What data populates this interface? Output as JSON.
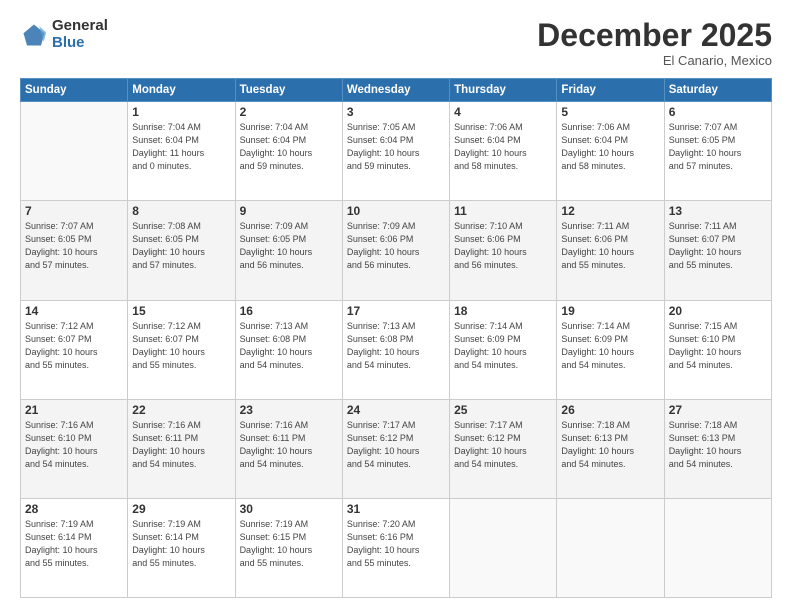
{
  "logo": {
    "general": "General",
    "blue": "Blue"
  },
  "header": {
    "month": "December 2025",
    "location": "El Canario, Mexico"
  },
  "weekdays": [
    "Sunday",
    "Monday",
    "Tuesday",
    "Wednesday",
    "Thursday",
    "Friday",
    "Saturday"
  ],
  "weeks": [
    [
      {
        "day": "",
        "info": ""
      },
      {
        "day": "1",
        "info": "Sunrise: 7:04 AM\nSunset: 6:04 PM\nDaylight: 11 hours\nand 0 minutes."
      },
      {
        "day": "2",
        "info": "Sunrise: 7:04 AM\nSunset: 6:04 PM\nDaylight: 10 hours\nand 59 minutes."
      },
      {
        "day": "3",
        "info": "Sunrise: 7:05 AM\nSunset: 6:04 PM\nDaylight: 10 hours\nand 59 minutes."
      },
      {
        "day": "4",
        "info": "Sunrise: 7:06 AM\nSunset: 6:04 PM\nDaylight: 10 hours\nand 58 minutes."
      },
      {
        "day": "5",
        "info": "Sunrise: 7:06 AM\nSunset: 6:04 PM\nDaylight: 10 hours\nand 58 minutes."
      },
      {
        "day": "6",
        "info": "Sunrise: 7:07 AM\nSunset: 6:05 PM\nDaylight: 10 hours\nand 57 minutes."
      }
    ],
    [
      {
        "day": "7",
        "info": "Sunrise: 7:07 AM\nSunset: 6:05 PM\nDaylight: 10 hours\nand 57 minutes."
      },
      {
        "day": "8",
        "info": "Sunrise: 7:08 AM\nSunset: 6:05 PM\nDaylight: 10 hours\nand 57 minutes."
      },
      {
        "day": "9",
        "info": "Sunrise: 7:09 AM\nSunset: 6:05 PM\nDaylight: 10 hours\nand 56 minutes."
      },
      {
        "day": "10",
        "info": "Sunrise: 7:09 AM\nSunset: 6:06 PM\nDaylight: 10 hours\nand 56 minutes."
      },
      {
        "day": "11",
        "info": "Sunrise: 7:10 AM\nSunset: 6:06 PM\nDaylight: 10 hours\nand 56 minutes."
      },
      {
        "day": "12",
        "info": "Sunrise: 7:11 AM\nSunset: 6:06 PM\nDaylight: 10 hours\nand 55 minutes."
      },
      {
        "day": "13",
        "info": "Sunrise: 7:11 AM\nSunset: 6:07 PM\nDaylight: 10 hours\nand 55 minutes."
      }
    ],
    [
      {
        "day": "14",
        "info": "Sunrise: 7:12 AM\nSunset: 6:07 PM\nDaylight: 10 hours\nand 55 minutes."
      },
      {
        "day": "15",
        "info": "Sunrise: 7:12 AM\nSunset: 6:07 PM\nDaylight: 10 hours\nand 55 minutes."
      },
      {
        "day": "16",
        "info": "Sunrise: 7:13 AM\nSunset: 6:08 PM\nDaylight: 10 hours\nand 54 minutes."
      },
      {
        "day": "17",
        "info": "Sunrise: 7:13 AM\nSunset: 6:08 PM\nDaylight: 10 hours\nand 54 minutes."
      },
      {
        "day": "18",
        "info": "Sunrise: 7:14 AM\nSunset: 6:09 PM\nDaylight: 10 hours\nand 54 minutes."
      },
      {
        "day": "19",
        "info": "Sunrise: 7:14 AM\nSunset: 6:09 PM\nDaylight: 10 hours\nand 54 minutes."
      },
      {
        "day": "20",
        "info": "Sunrise: 7:15 AM\nSunset: 6:10 PM\nDaylight: 10 hours\nand 54 minutes."
      }
    ],
    [
      {
        "day": "21",
        "info": "Sunrise: 7:16 AM\nSunset: 6:10 PM\nDaylight: 10 hours\nand 54 minutes."
      },
      {
        "day": "22",
        "info": "Sunrise: 7:16 AM\nSunset: 6:11 PM\nDaylight: 10 hours\nand 54 minutes."
      },
      {
        "day": "23",
        "info": "Sunrise: 7:16 AM\nSunset: 6:11 PM\nDaylight: 10 hours\nand 54 minutes."
      },
      {
        "day": "24",
        "info": "Sunrise: 7:17 AM\nSunset: 6:12 PM\nDaylight: 10 hours\nand 54 minutes."
      },
      {
        "day": "25",
        "info": "Sunrise: 7:17 AM\nSunset: 6:12 PM\nDaylight: 10 hours\nand 54 minutes."
      },
      {
        "day": "26",
        "info": "Sunrise: 7:18 AM\nSunset: 6:13 PM\nDaylight: 10 hours\nand 54 minutes."
      },
      {
        "day": "27",
        "info": "Sunrise: 7:18 AM\nSunset: 6:13 PM\nDaylight: 10 hours\nand 54 minutes."
      }
    ],
    [
      {
        "day": "28",
        "info": "Sunrise: 7:19 AM\nSunset: 6:14 PM\nDaylight: 10 hours\nand 55 minutes."
      },
      {
        "day": "29",
        "info": "Sunrise: 7:19 AM\nSunset: 6:14 PM\nDaylight: 10 hours\nand 55 minutes."
      },
      {
        "day": "30",
        "info": "Sunrise: 7:19 AM\nSunset: 6:15 PM\nDaylight: 10 hours\nand 55 minutes."
      },
      {
        "day": "31",
        "info": "Sunrise: 7:20 AM\nSunset: 6:16 PM\nDaylight: 10 hours\nand 55 minutes."
      },
      {
        "day": "",
        "info": ""
      },
      {
        "day": "",
        "info": ""
      },
      {
        "day": "",
        "info": ""
      }
    ]
  ]
}
